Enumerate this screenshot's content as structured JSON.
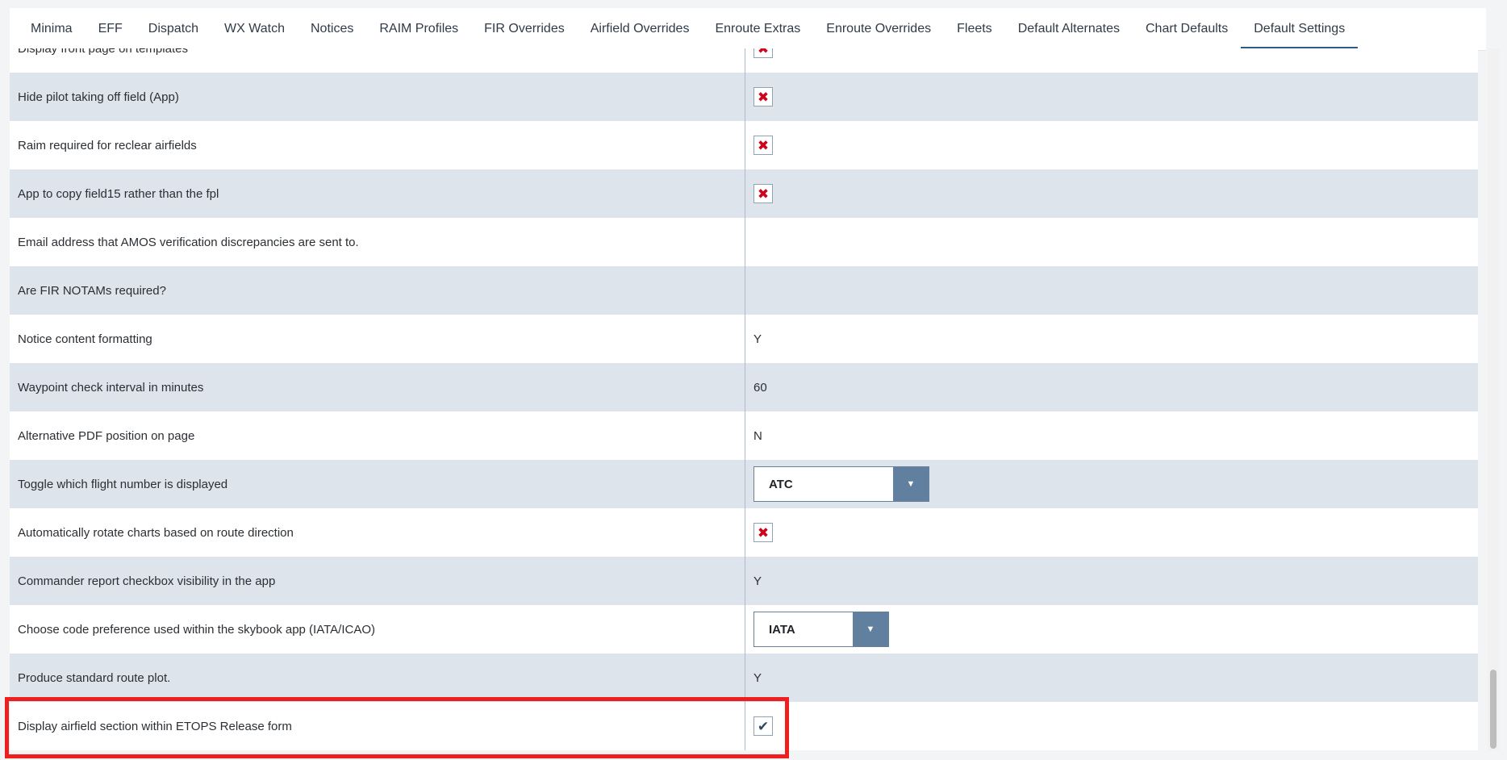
{
  "tabs": [
    {
      "label": "Minima",
      "active": false
    },
    {
      "label": "EFF",
      "active": false
    },
    {
      "label": "Dispatch",
      "active": false
    },
    {
      "label": "WX Watch",
      "active": false
    },
    {
      "label": "Notices",
      "active": false
    },
    {
      "label": "RAIM Profiles",
      "active": false
    },
    {
      "label": "FIR Overrides",
      "active": false
    },
    {
      "label": "Airfield Overrides",
      "active": false
    },
    {
      "label": "Enroute Extras",
      "active": false
    },
    {
      "label": "Enroute Overrides",
      "active": false
    },
    {
      "label": "Fleets",
      "active": false
    },
    {
      "label": "Default Alternates",
      "active": false
    },
    {
      "label": "Chart Defaults",
      "active": false
    },
    {
      "label": "Default Settings",
      "active": true
    }
  ],
  "settings": {
    "rows": [
      {
        "label": "Display front page on templates",
        "type": "checkbox",
        "checked": false
      },
      {
        "label": "Hide pilot taking off field (App)",
        "type": "checkbox",
        "checked": false
      },
      {
        "label": "Raim required for reclear airfields",
        "type": "checkbox",
        "checked": false
      },
      {
        "label": "App to copy field15 rather than the fpl",
        "type": "checkbox",
        "checked": false
      },
      {
        "label": "Email address that AMOS verification discrepancies are sent to.",
        "type": "text",
        "value": ""
      },
      {
        "label": "Are FIR NOTAMs required?",
        "type": "text",
        "value": ""
      },
      {
        "label": "Notice content formatting",
        "type": "text",
        "value": "Y"
      },
      {
        "label": "Waypoint check interval in minutes",
        "type": "text",
        "value": "60"
      },
      {
        "label": "Alternative PDF position on page",
        "type": "text",
        "value": "N"
      },
      {
        "label": "Toggle which flight number is displayed",
        "type": "select",
        "value": "ATC"
      },
      {
        "label": "Automatically rotate charts based on route direction",
        "type": "checkbox",
        "checked": false
      },
      {
        "label": "Commander report checkbox visibility in the app",
        "type": "text",
        "value": "Y"
      },
      {
        "label": "Choose code preference used within the skybook app (IATA/ICAO)",
        "type": "select",
        "value": "IATA"
      },
      {
        "label": "Produce standard route plot.",
        "type": "text",
        "value": "Y"
      },
      {
        "label": "Display airfield section within ETOPS Release form",
        "type": "checkbox",
        "checked": true
      }
    ]
  },
  "colors": {
    "active_tab_underline": "#2f5b82",
    "row_alt_background": "#dde4ec",
    "unchecked_mark": "#d0021b",
    "checked_mark": "#2f4b63",
    "select_button": "#61809f",
    "highlight_border": "#f01f1f"
  },
  "icons": {
    "unchecked": "close-x-icon",
    "checked": "checkmark-icon",
    "dropdown": "caret-down-icon"
  }
}
